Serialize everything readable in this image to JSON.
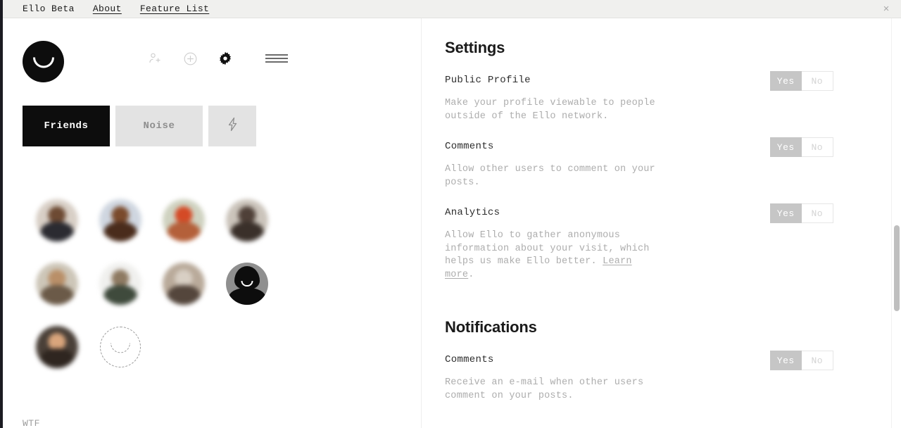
{
  "window": {
    "title": "Ello Beta",
    "close_label": "×"
  },
  "topbar": {
    "brand": "Ello Beta",
    "links": [
      {
        "label": "About"
      },
      {
        "label": "Feature List"
      }
    ]
  },
  "sidebar": {
    "logo_name": "ello-logo",
    "nav_icons": [
      {
        "name": "add-person-icon",
        "label": "Add person",
        "state": "inactive"
      },
      {
        "name": "plus-circle-icon",
        "label": "New post",
        "state": "inactive"
      },
      {
        "name": "gear-icon",
        "label": "Settings",
        "state": "active"
      },
      {
        "name": "hamburger-menu-icon",
        "label": "Menu",
        "state": "inactive"
      }
    ],
    "tabs": [
      {
        "label": "Friends",
        "active": true,
        "kind": "text"
      },
      {
        "label": "Noise",
        "active": false,
        "kind": "text"
      },
      {
        "label": "",
        "active": false,
        "kind": "lightning"
      }
    ],
    "avatars": [
      {
        "type": "photo",
        "tone_bg": "#d8cfc6",
        "tone_head": "#6d4a33",
        "tone_body": "#2b2b31"
      },
      {
        "type": "photo",
        "tone_bg": "#cfd6e0",
        "tone_head": "#7a4a2c",
        "tone_body": "#4a2c1c"
      },
      {
        "type": "photo",
        "tone_bg": "#cfd2c0",
        "tone_head": "#d44a26",
        "tone_body": "#b4603a"
      },
      {
        "type": "photo",
        "tone_bg": "#cbc4bb",
        "tone_head": "#4f4038",
        "tone_body": "#3a302a"
      },
      {
        "type": "photo",
        "tone_bg": "#cdc6b8",
        "tone_head": "#b98f68",
        "tone_body": "#6b5a48"
      },
      {
        "type": "photo",
        "tone_bg": "#f0f0ee",
        "tone_head": "#8e7a62",
        "tone_body": "#3f4a3c"
      },
      {
        "type": "photo",
        "tone_bg": "#b9aa9a",
        "tone_head": "#d8cfc4",
        "tone_body": "#54463c"
      },
      {
        "type": "default"
      },
      {
        "type": "photo",
        "tone_bg": "#4a4038",
        "tone_head": "#d9a57c",
        "tone_body": "#2f2620"
      },
      {
        "type": "placeholder"
      }
    ],
    "footer_label": "WTF"
  },
  "settings": {
    "sections": [
      {
        "title": "Settings",
        "items": [
          {
            "label": "Public Profile",
            "description": "Make your profile viewable to people\noutside of the Ello network.",
            "toggle": {
              "yes": "Yes",
              "no": "No",
              "value": "Yes"
            }
          },
          {
            "label": "Comments",
            "description": "Allow other users to comment on your\nposts.",
            "toggle": {
              "yes": "Yes",
              "no": "No",
              "value": "Yes"
            }
          },
          {
            "label": "Analytics",
            "description_pre": "Allow Ello to gather anonymous information about your visit, which helps us make Ello better. ",
            "description_link": "Learn more",
            "description_post": ".",
            "toggle": {
              "yes": "Yes",
              "no": "No",
              "value": "Yes"
            }
          }
        ]
      },
      {
        "title": "Notifications",
        "items": [
          {
            "label": "Comments",
            "description": "Receive an e-mail when other users\ncomment on your posts.",
            "toggle": {
              "yes": "Yes",
              "no": "No",
              "value": "Yes"
            }
          }
        ]
      }
    ]
  },
  "colors": {
    "accent_dark": "#0d0d0d",
    "topbar_bg": "#f0f0ee",
    "tab_inactive_bg": "#e3e3e3",
    "toggle_on_bg": "#c6c6c6",
    "muted_text": "#adadad",
    "scrollbar_thumb": "#bfbfbf"
  }
}
